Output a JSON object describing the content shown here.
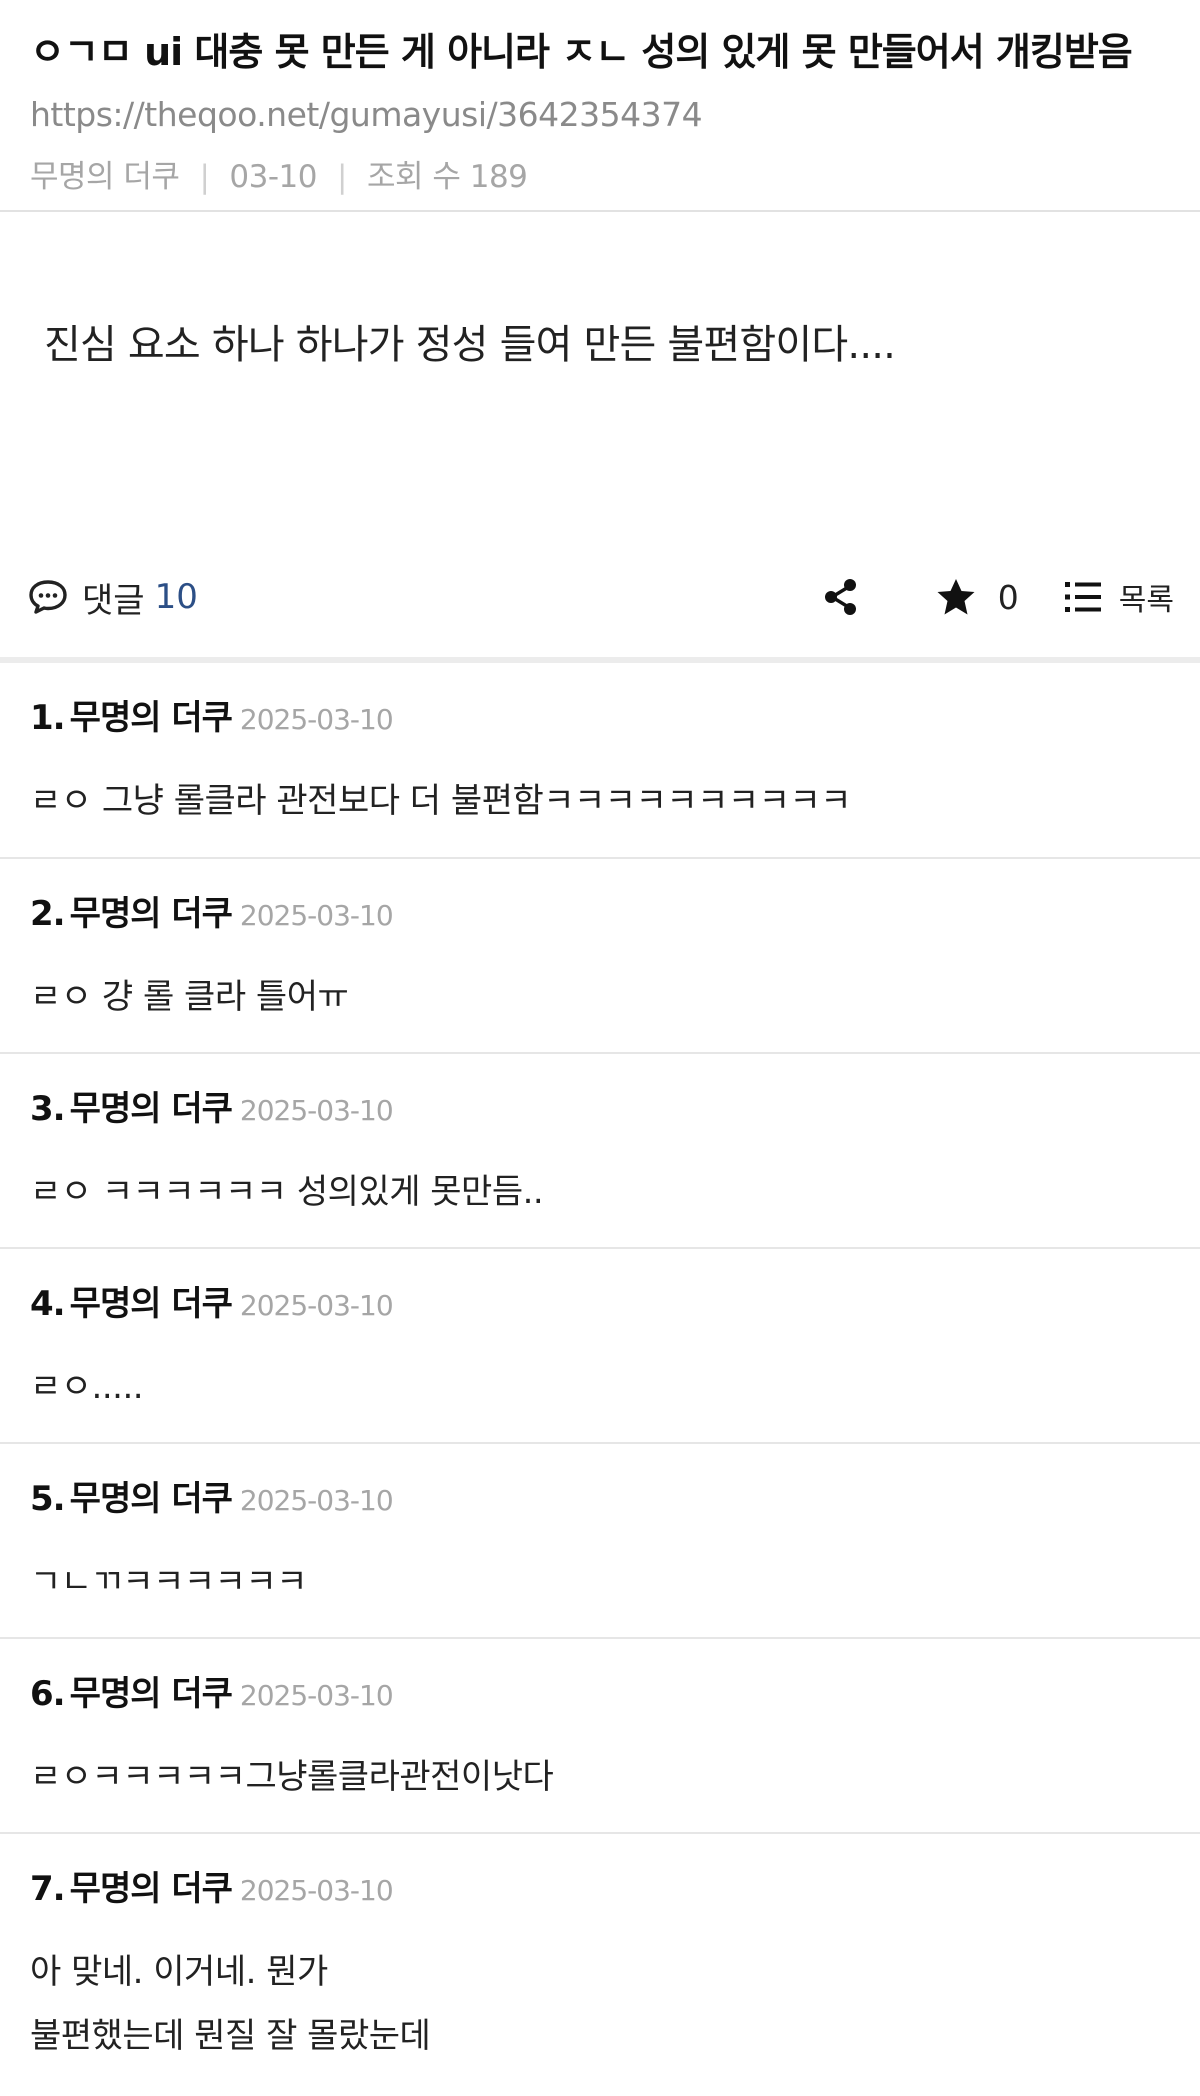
{
  "post": {
    "title": "ㅇㄱㅁ ui 대충 못 만든 게 아니라 ㅈㄴ 성의 있게 못 만들어서 개킹받음",
    "url": "https://theqoo.net/gumayusi/3642354374",
    "author": "무명의 더쿠",
    "date": "03-10",
    "views_label": "조회 수 189",
    "body": "진심 요소 하나 하나가 정성 들여 만든 불편함이다...."
  },
  "actions": {
    "comment_label": "댓글",
    "comment_count": "10",
    "star_count": "0",
    "list_label": "목록"
  },
  "comments": [
    {
      "num": "1.",
      "name": "무명의 더쿠",
      "date": "2025-03-10",
      "lines": [
        "ㄹㅇ 그냥 롤클라 관전보다 더 불편함ㅋㅋㅋㅋㅋㅋㅋㅋㅋㅋ"
      ]
    },
    {
      "num": "2.",
      "name": "무명의 더쿠",
      "date": "2025-03-10",
      "lines": [
        "ㄹㅇ 걍 롤 클라 틀어ㅠ"
      ]
    },
    {
      "num": "3.",
      "name": "무명의 더쿠",
      "date": "2025-03-10",
      "lines": [
        "ㄹㅇ ㅋㅋㅋㅋㅋㅋ 성의있게 못만듬.."
      ]
    },
    {
      "num": "4.",
      "name": "무명의 더쿠",
      "date": "2025-03-10",
      "lines": [
        "ㄹㅇ....."
      ]
    },
    {
      "num": "5.",
      "name": "무명의 더쿠",
      "date": "2025-03-10",
      "lines": [
        "ㄱㄴㄲㅋㅋㅋㅋㅋㅋ"
      ]
    },
    {
      "num": "6.",
      "name": "무명의 더쿠",
      "date": "2025-03-10",
      "lines": [
        "ㄹㅇㅋㅋㅋㅋㅋ그냥롤클라관전이낫다"
      ]
    },
    {
      "num": "7.",
      "name": "무명의 더쿠",
      "date": "2025-03-10",
      "lines": [
        "아 맞네. 이거네. 뭔가",
        "불편했는데 뭔질 잘 몰랐눈데"
      ]
    }
  ]
}
